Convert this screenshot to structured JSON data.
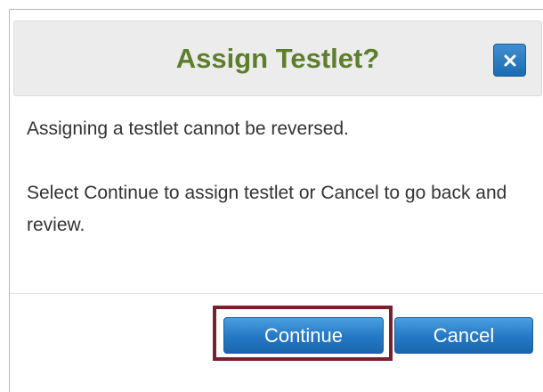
{
  "dialog": {
    "title": "Assign Testlet?",
    "close_icon": "close-icon",
    "message_1": "Assigning a testlet cannot be reversed.",
    "message_2": "Select Continue to assign testlet or Cancel to go back and review.",
    "continue_label": "Continue",
    "cancel_label": "Cancel"
  },
  "colors": {
    "title_text": "#5d7f2c",
    "button_blue": "#2478c4",
    "focus_outline": "#7b1f2e",
    "body_text": "#333333"
  }
}
